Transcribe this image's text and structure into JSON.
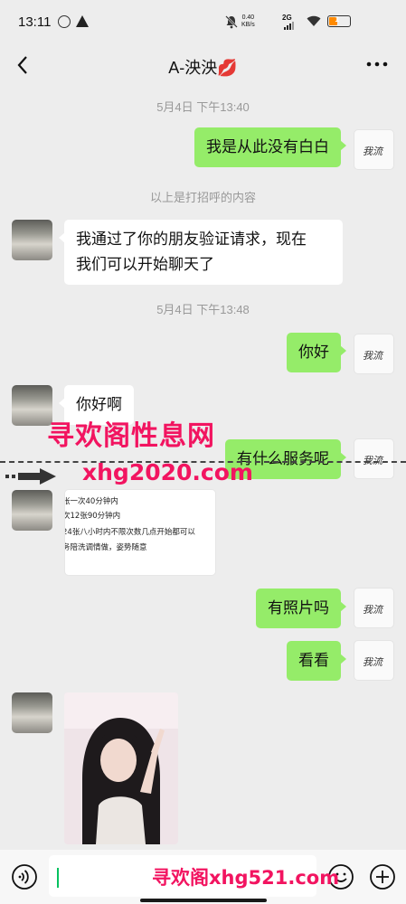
{
  "status_bar": {
    "time": "13:11",
    "net_speed_value": "0.40",
    "net_speed_unit": "KB/s",
    "network": "2G",
    "battery": "1",
    "icons": [
      "notification-ring-icon",
      "warning-icon",
      "mute-bell-icon",
      "signal-icon",
      "wifi-icon",
      "battery-icon"
    ]
  },
  "nav": {
    "title": "A-泱泱💋",
    "back_icon": "chevron-left-icon",
    "more_icon": "more-dots-icon"
  },
  "timestamps": [
    "5月4日 下午13:40",
    "5月4日 下午13:48"
  ],
  "system_notice": "以上是打招呼的内容",
  "messages": [
    {
      "side": "me",
      "text": "我是从此没有白白"
    },
    {
      "side": "her",
      "text_line1": "我通过了你的朋友验证请求，现在",
      "text_line2": "我们可以开始聊天了"
    },
    {
      "side": "me",
      "text": "你好"
    },
    {
      "side": "her",
      "text": "你好啊"
    },
    {
      "side": "me",
      "text": "有什么服务呢"
    },
    {
      "side": "her",
      "type": "image-text",
      "lines": [
        "张一次40分钟内",
        "次12张90分钟内",
        "24张八小时内不限次数几点开始都可以",
        "务陪洗调情做，姿势随意"
      ]
    },
    {
      "side": "me",
      "text": "有照片吗"
    },
    {
      "side": "me",
      "text": "看看"
    },
    {
      "side": "her",
      "type": "photo"
    }
  ],
  "my_avatar_text": "我流",
  "watermarks": {
    "top": "寻欢阁性息网",
    "middle": "xhg2020.com",
    "bottom": "寻欢阁xhg521.com"
  },
  "input_bar": {
    "input_value": "",
    "icons": [
      "voice-icon",
      "emoji-icon",
      "plus-icon"
    ]
  },
  "colors": {
    "my_bubble": "#95ec69",
    "their_bubble": "#ffffff",
    "background": "#ededed",
    "watermark": "#f21460"
  }
}
